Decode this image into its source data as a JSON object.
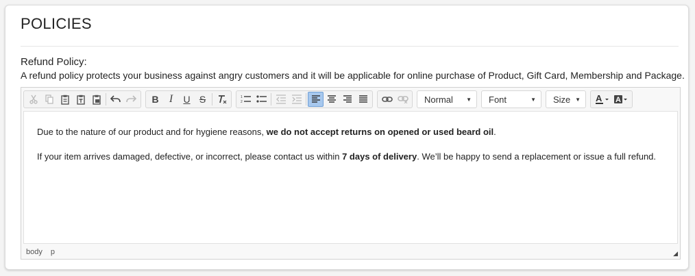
{
  "section": {
    "title": "POLICIES",
    "field_label": "Refund Policy:",
    "field_description": "A refund policy protects your business against angry customers and it will be applicable for online purchase of Product, Gift Card, Membership and Package."
  },
  "toolbar": {
    "format_value": "Normal",
    "font_value": "Font",
    "size_value": "Size",
    "active_alignment": "align-left"
  },
  "content": {
    "p1_text": "Due to the nature of our product and for hygiene reasons, ",
    "p1_bold": "we do not accept returns on opened or used beard oil",
    "p1_end": ".",
    "p2_text": "If your item arrives damaged, defective, or incorrect, please contact us within ",
    "p2_bold": "7 days of delivery",
    "p2_end": ". We’ll be happy to send a replacement or issue a full refund."
  },
  "elements_path": [
    "body",
    "p"
  ],
  "colors": {
    "active_button": "#a7c8ee"
  }
}
